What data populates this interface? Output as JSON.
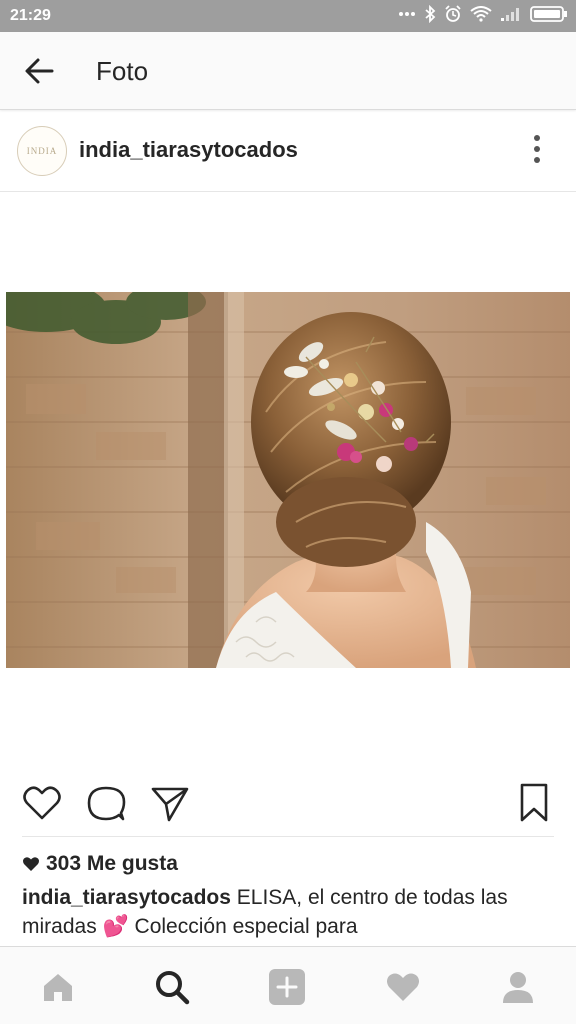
{
  "status_bar": {
    "time": "21:29",
    "icons": [
      "more-dots-icon",
      "bluetooth-icon",
      "alarm-icon",
      "wifi-icon",
      "signal-icon",
      "battery-icon"
    ]
  },
  "app_bar": {
    "title": "Foto",
    "back_icon": "arrow-left-icon"
  },
  "post": {
    "avatar_text": "INDIA",
    "username": "india_tiarasytocados",
    "more_icon": "vertical-dots-icon",
    "image_subject": "bridal hairstyle with floral hair accessory",
    "actions": [
      "heart-icon",
      "comment-icon",
      "share-icon",
      "bookmark-icon"
    ],
    "likes": "303 Me gusta",
    "caption_user": "india_tiarasytocados",
    "caption_text": "ELISA, el centro de todas las miradas",
    "caption_emoji": "💕",
    "caption_more": "Colección especial para"
  },
  "bottom_nav": [
    "home-icon",
    "search-icon",
    "add-icon",
    "activity-heart-icon",
    "profile-icon"
  ],
  "colors": {
    "status_bar": "#9e9e9e",
    "text": "#262626",
    "icon": "#262626",
    "inactive_icon": "#b8b8b8",
    "heart_emoji": "#e0427a"
  }
}
